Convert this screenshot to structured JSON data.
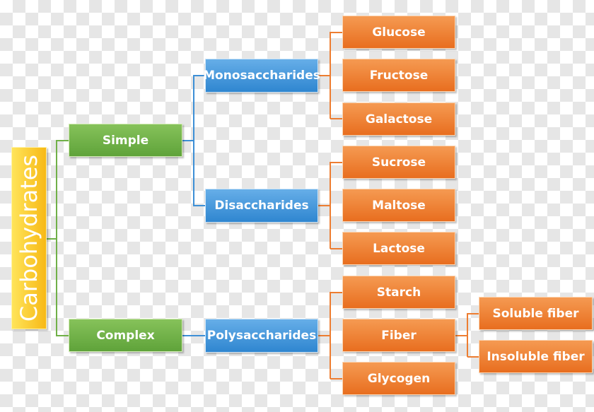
{
  "root": "Carbohydrates",
  "level1": [
    "Simple",
    "Complex"
  ],
  "level2": [
    "Monosaccharides",
    "Disaccharides",
    "Polysaccharides"
  ],
  "level3": [
    "Glucose",
    "Fructose",
    "Galactose",
    "Sucrose",
    "Maltose",
    "Lactose",
    "Starch",
    "Fiber",
    "Glycogen"
  ],
  "level4": [
    "Soluble fiber",
    "Insoluble fiber"
  ],
  "colors": {
    "root": "#f7c325",
    "level1": "#70b048",
    "level2": "#3d8fd6",
    "level3": "#ed7d31"
  }
}
